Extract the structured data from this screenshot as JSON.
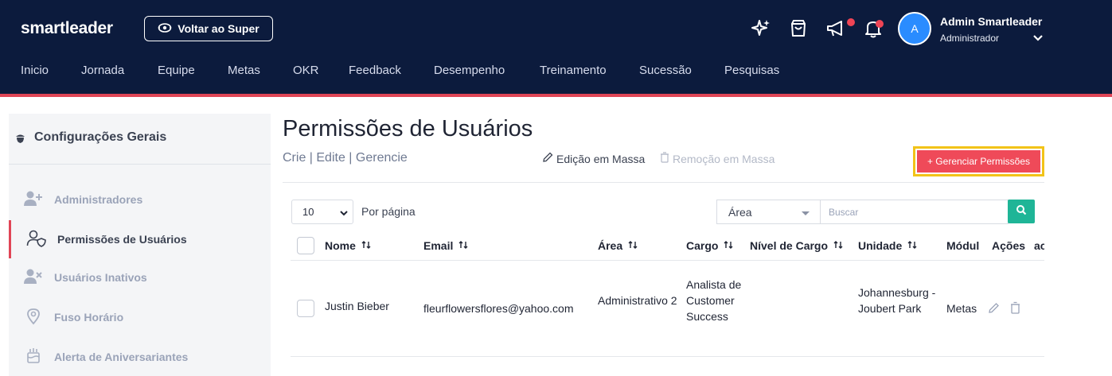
{
  "header": {
    "logo": "smartleader",
    "back_button_label": "Voltar ao Super",
    "icons": [
      "sparkles-icon",
      "shopping-bag-icon",
      "megaphone-icon",
      "bell-icon"
    ],
    "user": {
      "initial": "A",
      "name": "Admin Smartleader",
      "role": "Administrador"
    }
  },
  "nav": {
    "items": [
      "Inicio",
      "Jornada",
      "Equipe",
      "Metas",
      "OKR",
      "Feedback",
      "Desempenho",
      "Treinamento",
      "Sucessão",
      "Pesquisas"
    ]
  },
  "sidebar": {
    "title": "Configurações Gerais",
    "items": [
      {
        "label": "Administradores",
        "icon": "user-plus-icon",
        "active": false
      },
      {
        "label": "Permissões de Usuários",
        "icon": "user-shield-icon",
        "active": true
      },
      {
        "label": "Usuários Inativos",
        "icon": "user-x-icon",
        "active": false
      },
      {
        "label": "Fuso Horário",
        "icon": "location-pin-icon",
        "active": false
      },
      {
        "label": "Alerta de Aniversariantes",
        "icon": "cake-icon",
        "active": false
      }
    ]
  },
  "main": {
    "title": "Permissões de Usuários",
    "subtitle": "Crie | Edite | Gerencie",
    "mass_edit_label": "Edição em Massa",
    "mass_remove_label": "Remoção em Massa",
    "manage_button_label": "+ Gerenciar Permissões",
    "per_page_value": "10",
    "per_page_label": "Por página",
    "area_filter_value": "Área",
    "search_placeholder": "Buscar"
  },
  "table": {
    "columns": [
      "Nome",
      "Email",
      "Área",
      "Cargo",
      "Nível de Cargo",
      "Unidade",
      "Módul",
      "Ações",
      "ac"
    ],
    "rows": [
      {
        "nome": "Justin Bieber",
        "email": "fleurflowersflores@yahoo.com",
        "area": "Administrativo 2",
        "cargo": "Analista de Customer Success",
        "nivel": "",
        "unidade": "Johannesburg - Joubert Park",
        "modulo": "Metas"
      }
    ]
  },
  "colors": {
    "header_bg": "#0c1b3d",
    "accent_red": "#ef4a59",
    "highlight_yellow": "#f2c318",
    "search_green": "#1fb597"
  }
}
